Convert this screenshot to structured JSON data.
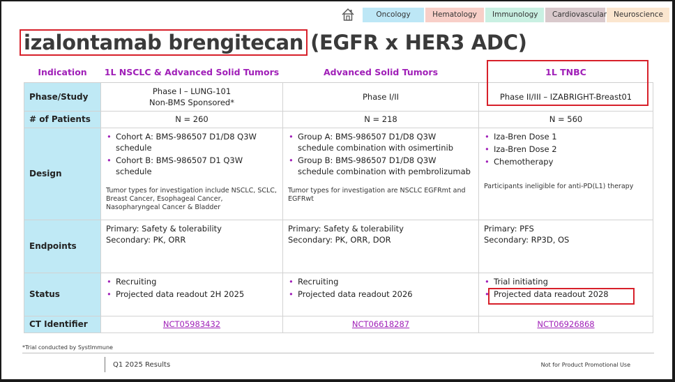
{
  "nav": {
    "tabs": [
      {
        "label": "Oncology",
        "color": "#bde7f6"
      },
      {
        "label": "Hematology",
        "color": "#f8cfc8"
      },
      {
        "label": "Immunology",
        "color": "#c9f0e2"
      },
      {
        "label": "Cardiovascular",
        "color": "#d9c9cc"
      },
      {
        "label": "Neuroscience",
        "color": "#fbe6cf"
      }
    ]
  },
  "title": {
    "drug": "izalontamab brengitecan",
    "rest": "(EGFR x HER3 ADC)"
  },
  "table": {
    "header": {
      "indication": "Indication",
      "col1": "1L NSCLC & Advanced Solid Tumors",
      "col2": "Advanced Solid Tumors",
      "col3": "1L TNBC"
    },
    "phase": {
      "label": "Phase/Study",
      "col1_line1": "Phase I – LUNG-101",
      "col1_line2": "Non-BMS Sponsored*",
      "col2": "Phase I/II",
      "col3": "Phase II/III – IZABRIGHT-Breast01"
    },
    "patients": {
      "label": "# of Patients",
      "col1": "N = 260",
      "col2": "N = 218",
      "col3": "N = 560"
    },
    "design": {
      "label": "Design",
      "col1_items": [
        "Cohort A: BMS-986507 D1/D8 Q3W schedule",
        "Cohort B: BMS-986507 D1 Q3W schedule"
      ],
      "col1_note": "Tumor types for investigation include NSCLC, SCLC, Breast Cancer, Esophageal Cancer, Nasopharyngeal Cancer & Bladder",
      "col2_items": [
        "Group A: BMS-986507 D1/D8 Q3W schedule combination with osimertinib",
        "Group B: BMS-986507 D1/D8 Q3W schedule combination with pembrolizumab"
      ],
      "col2_note": "Tumor types for investigation are NSCLC EGFRmt and EGFRwt",
      "col3_items": [
        "Iza-Bren Dose 1",
        "Iza-Bren Dose 2",
        "Chemotherapy"
      ],
      "col3_note": "Participants ineligible for anti-PD(L1) therapy"
    },
    "endpoints": {
      "label": "Endpoints",
      "col1_primary": "Primary: Safety & tolerability",
      "col1_secondary": "Secondary: PK, ORR",
      "col2_primary": "Primary: Safety & tolerability",
      "col2_secondary": "Secondary: PK, ORR, DOR",
      "col3_primary": "Primary: PFS",
      "col3_secondary": "Secondary: RP3D, OS"
    },
    "status": {
      "label": "Status",
      "col1_items": [
        "Recruiting",
        "Projected data readout 2H 2025"
      ],
      "col2_items": [
        "Recruiting",
        "Projected data readout 2026"
      ],
      "col3_items": [
        "Trial initiating",
        "Projected data readout 2028"
      ]
    },
    "ct": {
      "label": "CT Identifier",
      "col1": "NCT05983432",
      "col2": "NCT06618287",
      "col3": "NCT06926868"
    }
  },
  "footer": {
    "footnote": "*Trial conducted by SystImmune",
    "left": "Q1 2025 Results",
    "right": "Not for Product Promotional Use"
  }
}
